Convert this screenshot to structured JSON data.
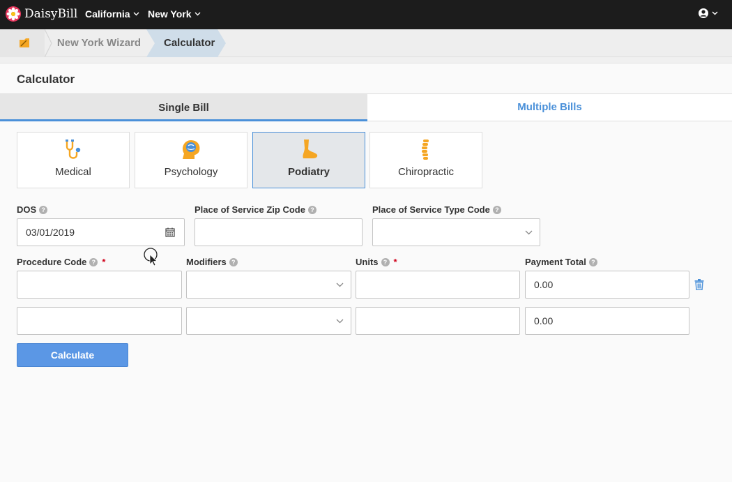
{
  "app": {
    "brand": "DaisyBill",
    "nav": [
      {
        "label": "California"
      },
      {
        "label": "New York"
      }
    ]
  },
  "breadcrumb": {
    "items": [
      {
        "label": "New York Wizard"
      },
      {
        "label": "Calculator"
      }
    ]
  },
  "page": {
    "title": "Calculator"
  },
  "tabs": [
    {
      "label": "Single Bill",
      "active": true
    },
    {
      "label": "Multiple Bills",
      "active": false
    }
  ],
  "specialties": [
    {
      "label": "Medical",
      "icon": "stethoscope-icon"
    },
    {
      "label": "Psychology",
      "icon": "brain-icon"
    },
    {
      "label": "Podiatry",
      "icon": "foot-icon",
      "active": true
    },
    {
      "label": "Chiropractic",
      "icon": "spine-icon"
    }
  ],
  "form": {
    "dos": {
      "label": "DOS",
      "value": "03/01/2019"
    },
    "zip": {
      "label": "Place of Service Zip Code",
      "value": ""
    },
    "type_code": {
      "label": "Place of Service Type Code",
      "value": ""
    },
    "columns": {
      "procedure": "Procedure Code",
      "modifiers": "Modifiers",
      "units": "Units",
      "payment": "Payment Total"
    },
    "rows": [
      {
        "procedure": "",
        "modifiers": "",
        "units": "",
        "payment": "0.00"
      },
      {
        "procedure": "",
        "modifiers": "",
        "units": "",
        "payment": "0.00"
      }
    ],
    "required_mark": "*",
    "help_mark": "?",
    "submit_label": "Calculate"
  },
  "colors": {
    "accent": "#4a90d9",
    "button": "#5b97e5",
    "topbar": "#1c1c1c",
    "required": "#d0021b",
    "icon_yellow": "#f5a623"
  }
}
